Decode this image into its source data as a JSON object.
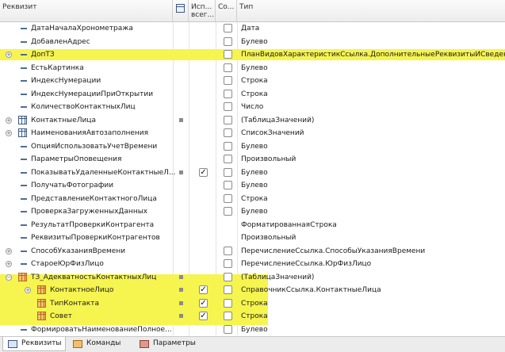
{
  "header": {
    "col_name": "Реквизит",
    "col_use_l1": "Исп...",
    "col_use_l2": "всег...",
    "col_sort": "Со...",
    "col_type": "Тип"
  },
  "rows": [
    {
      "name": "ДатаНачалаХронометража",
      "type": "Дата",
      "icon": "line",
      "exp": "",
      "mark": false,
      "chk2": false,
      "hl": false,
      "indent": 0
    },
    {
      "name": "ДобавленАдрес",
      "type": "Булево",
      "icon": "line",
      "exp": "",
      "mark": false,
      "chk2": false,
      "hl": false,
      "indent": 0
    },
    {
      "name": "ДопТЗ",
      "type": "ПланВидовХарактеристикСсылка.ДополнительныеРеквизитыИСведения",
      "icon": "line",
      "exp": "+",
      "mark": false,
      "chk2": false,
      "hl": true,
      "indent": 0
    },
    {
      "name": "ЕстьКартинка",
      "type": "Булево",
      "icon": "line",
      "exp": "",
      "mark": false,
      "chk2": false,
      "hl": false,
      "indent": 0
    },
    {
      "name": "ИндексНумерации",
      "type": "Строка",
      "icon": "line",
      "exp": "",
      "mark": false,
      "chk2": false,
      "hl": false,
      "indent": 0
    },
    {
      "name": "ИндексНумерацииПриОткрытии",
      "type": "Строка",
      "icon": "line",
      "exp": "",
      "mark": false,
      "chk2": false,
      "hl": false,
      "indent": 0
    },
    {
      "name": "КоличествоКонтактныхЛиц",
      "type": "Число",
      "icon": "line",
      "exp": "",
      "mark": false,
      "chk2": false,
      "hl": false,
      "indent": 0
    },
    {
      "name": "КонтактныеЛица",
      "type": "(ТаблицаЗначений)",
      "icon": "table",
      "exp": "+",
      "mark": true,
      "chk2": false,
      "hl": false,
      "indent": 0
    },
    {
      "name": "НаименованияАвтозаполнения",
      "type": "СписокЗначений",
      "icon": "table",
      "exp": "+",
      "mark": false,
      "chk2": false,
      "hl": false,
      "indent": 0
    },
    {
      "name": "ОпцияИспользоватьУчетВремени",
      "type": "Булево",
      "icon": "line",
      "exp": "",
      "mark": false,
      "chk2": false,
      "hl": false,
      "indent": 0
    },
    {
      "name": "ПараметрыОповещения",
      "type": "Произвольный",
      "icon": "line",
      "exp": "",
      "mark": false,
      "chk2": false,
      "hl": false,
      "indent": 0
    },
    {
      "name": "ПоказыватьУдаленныеКонтактныеЛ...",
      "type": "Булево",
      "icon": "line",
      "exp": "",
      "mark": true,
      "chk2": true,
      "hl": false,
      "indent": 0
    },
    {
      "name": "ПолучатьФотографии",
      "type": "Булево",
      "icon": "line",
      "exp": "",
      "mark": false,
      "chk2": false,
      "hl": false,
      "indent": 0
    },
    {
      "name": "ПредставлениеКонтактногоЛица",
      "type": "Строка",
      "icon": "line",
      "exp": "",
      "mark": false,
      "chk2": false,
      "hl": false,
      "indent": 0
    },
    {
      "name": "ПроверкаЗагруженныхДанных",
      "type": "Булево",
      "icon": "line",
      "exp": "",
      "mark": false,
      "chk2": false,
      "hl": false,
      "indent": 0
    },
    {
      "name": "РезультатПроверкиКонтрагента",
      "type": "ФорматированнаяСтрока",
      "icon": "line",
      "exp": "",
      "mark": false,
      "chk2": null,
      "hl": false,
      "indent": 0
    },
    {
      "name": "РеквизитыПроверкиКонтрагентов",
      "type": "Произвольный",
      "icon": "line",
      "exp": "",
      "mark": false,
      "chk2": null,
      "hl": false,
      "indent": 0
    },
    {
      "name": "СпособУказанияВремени",
      "type": "ПеречислениеСсылка.СпособыУказанияВремени",
      "icon": "line",
      "exp": "+",
      "mark": false,
      "chk2": false,
      "hl": false,
      "indent": 0
    },
    {
      "name": "СтароеЮрФизЛицо",
      "type": "ПеречислениеСсылка.ЮрФизЛицо",
      "icon": "line",
      "exp": "+",
      "mark": false,
      "chk2": false,
      "hl": false,
      "indent": 0
    },
    {
      "name": "ТЗ_АдекватностьКонтактныхЛиц",
      "type": "(ТаблицаЗначений)",
      "icon": "table-orange",
      "exp": "-",
      "mark": true,
      "chk2": false,
      "hl": true,
      "indent": 0
    },
    {
      "name": "КонтактноеЛицо",
      "type": "СправочникСсылка.КонтактныеЛица",
      "icon": "table-orange",
      "exp": "+",
      "mark": true,
      "chk2": true,
      "hl": true,
      "indent": 1
    },
    {
      "name": "ТипКонтакта",
      "type": "Строка",
      "icon": "table-orange",
      "exp": "",
      "mark": true,
      "chk2": true,
      "hl": true,
      "indent": 1
    },
    {
      "name": "Совет",
      "type": "Строка",
      "icon": "table-orange",
      "exp": "",
      "mark": true,
      "chk2": true,
      "hl": true,
      "indent": 1
    },
    {
      "name": "ФормироватьНаименованиеПолное...",
      "type": "Булево",
      "icon": "line",
      "exp": "",
      "mark": false,
      "chk2": false,
      "hl": false,
      "indent": 0
    }
  ],
  "tabs": [
    {
      "label": "Реквизиты",
      "active": true,
      "icon": "blue"
    },
    {
      "label": "Команды",
      "active": false,
      "icon": "orange"
    },
    {
      "label": "Параметры",
      "active": false,
      "icon": "red"
    }
  ],
  "colors": {
    "highlight": "#f6f44f",
    "icon_blue": "#3b5a86",
    "icon_orange": "#b9651a"
  }
}
